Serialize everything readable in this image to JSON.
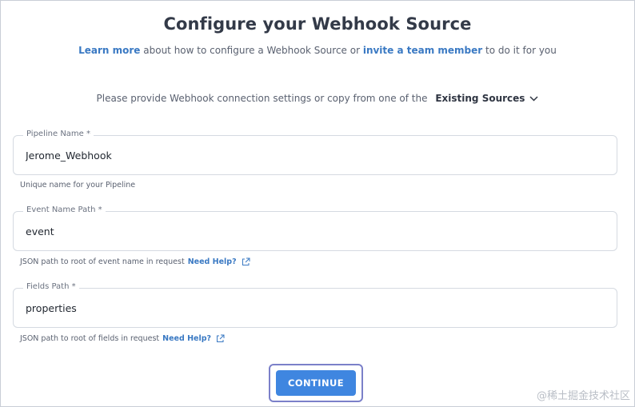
{
  "header": {
    "title": "Configure your Webhook Source",
    "subtitle_link_1": "Learn more",
    "subtitle_text_1": " about how to configure a Webhook Source or ",
    "subtitle_link_2": "invite a team member",
    "subtitle_text_2": " to do it for you"
  },
  "source_select": {
    "prompt": "Please provide Webhook connection settings or copy from one of the",
    "dropdown_label": "Existing Sources"
  },
  "fields": {
    "pipeline_name": {
      "label": "Pipeline Name *",
      "value": "Jerome_Webhook",
      "hint": "Unique name for your Pipeline"
    },
    "event_name_path": {
      "label": "Event Name Path *",
      "value": "event",
      "hint": "JSON path to root of event name in request",
      "help_link": "Need Help?"
    },
    "fields_path": {
      "label": "Fields Path *",
      "value": "properties",
      "hint": "JSON path to root of fields in request",
      "help_link": "Need Help?"
    }
  },
  "actions": {
    "continue_label": "CONTINUE"
  },
  "watermark": "@稀土掘金技术社区",
  "colors": {
    "accent": "#3f86e0",
    "link": "#3a79c3",
    "focus_ring": "#7b80c9"
  },
  "icons": {
    "dropdown": "chevron-down-icon",
    "external": "external-link-icon"
  }
}
